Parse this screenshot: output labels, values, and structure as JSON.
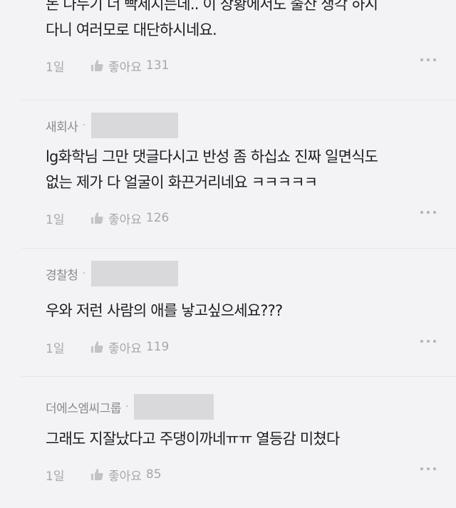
{
  "comments": [
    {
      "author": "",
      "lines": [
        "돈 나누기 너 빡세지는데.. 이 상황에서도 출산 생각 하시",
        "다니 여러모로 대단하시네요."
      ],
      "date": "1일",
      "like_label": "좋아요",
      "like_count": "131"
    },
    {
      "author": "새회사",
      "lines": [
        "lg화학님 그만 댓글다시고 반성 좀 하십쇼 진짜 일면식도",
        "없는 제가 다 얼굴이 화끈거리네요 ㅋㅋㅋㅋㅋ"
      ],
      "date": "1일",
      "like_label": "좋아요",
      "like_count": "126"
    },
    {
      "author": "경찰청",
      "lines": [
        "우와 저런 사람의 애를 낳고싶으세요???"
      ],
      "date": "1일",
      "like_label": "좋아요",
      "like_count": "119"
    },
    {
      "author": "더에스엠씨그룹",
      "lines": [
        "그래도 지잘났다고 주댕이까네ㅠㅠ 열등감 미쳤다"
      ],
      "date": "1일",
      "like_label": "좋아요",
      "like_count": "85"
    }
  ],
  "icons": {
    "like": "thumbs-up-icon",
    "more": "more-options-icon"
  },
  "colors": {
    "background": "#f3f3f5",
    "meta_text": "#a7a7ab",
    "redaction": "#d9d9dc"
  }
}
